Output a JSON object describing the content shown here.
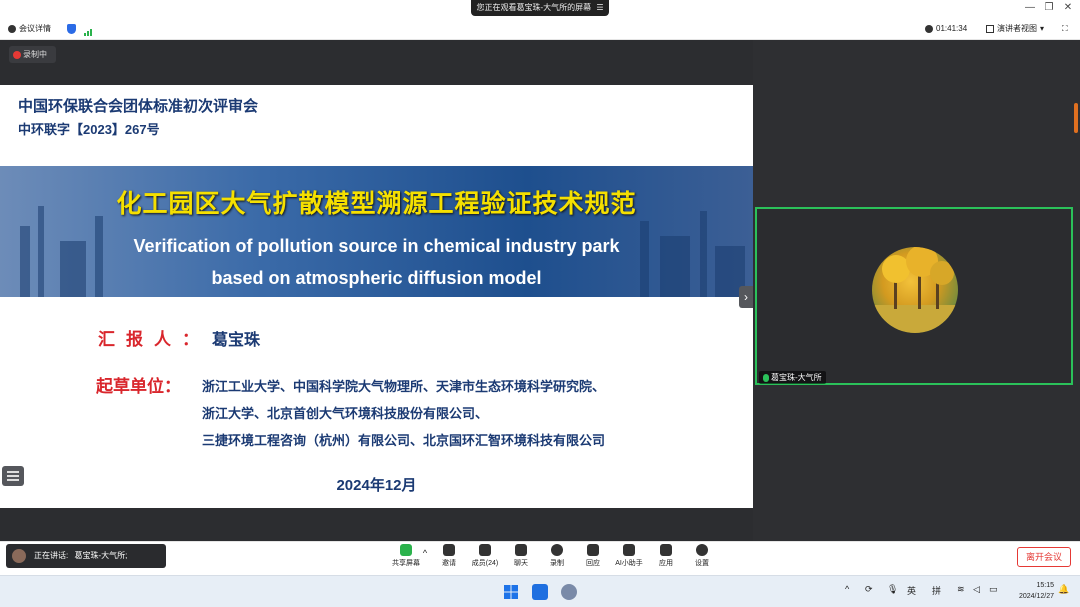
{
  "window": {
    "share_banner": "您正在观看葛宝珠-大气所的屏幕",
    "share_banner_icon": "menu-icon"
  },
  "topbar": {
    "meeting_details": "会议详情",
    "timer": "01:41:34",
    "view_mode": "演讲者视图"
  },
  "recording": {
    "label": "录制中"
  },
  "slide": {
    "header_line1": "中国环保联合会团体标准初次评审会",
    "header_line2": "中环联字【2023】267号",
    "title_cn": "化工园区大气扩散模型溯源工程验证技术规范",
    "title_en_line1": "Verification of pollution source in chemical industry park",
    "title_en_line2": "based on atmospheric diffusion model",
    "reporter_label": "汇报人：",
    "reporter_name": "葛宝珠",
    "drafter_label": "起草单位：",
    "drafters": [
      "浙江工业大学、中国科学院大气物理所、天津市生态环境科学研究院、",
      "浙江大学、北京首创大气环境科技股份有限公司、",
      "三捷环境工程咨询（杭州）有限公司、北京国环汇智环境科技有限公司"
    ],
    "date": "2024年12月"
  },
  "participant": {
    "name": "葛宝珠-大气所"
  },
  "speaking": {
    "label": "正在讲话:",
    "name": "葛宝珠-大气所;"
  },
  "controls": [
    {
      "label": "共享屏幕",
      "icon": "screen-share-icon"
    },
    {
      "label": "邀请",
      "icon": "invite-icon"
    },
    {
      "label": "成员(24)",
      "icon": "members-icon"
    },
    {
      "label": "聊天",
      "icon": "chat-icon"
    },
    {
      "label": "录制",
      "icon": "record-icon"
    },
    {
      "label": "回应",
      "icon": "reaction-icon"
    },
    {
      "label": "AI小助手",
      "icon": "ai-assistant-icon"
    },
    {
      "label": "应用",
      "icon": "apps-icon"
    },
    {
      "label": "设置",
      "icon": "settings-icon"
    }
  ],
  "leave_button": "离开会议",
  "taskbar": {
    "ime_lang": "英",
    "ime_mode": "拼",
    "time": "15:15",
    "date": "2024/12/27"
  },
  "colors": {
    "accent_green": "#2bc15a",
    "leave_red": "#e53935",
    "slide_title_yellow": "#f5e000",
    "slide_navy": "#1b3a73",
    "slide_red": "#d9262c"
  }
}
